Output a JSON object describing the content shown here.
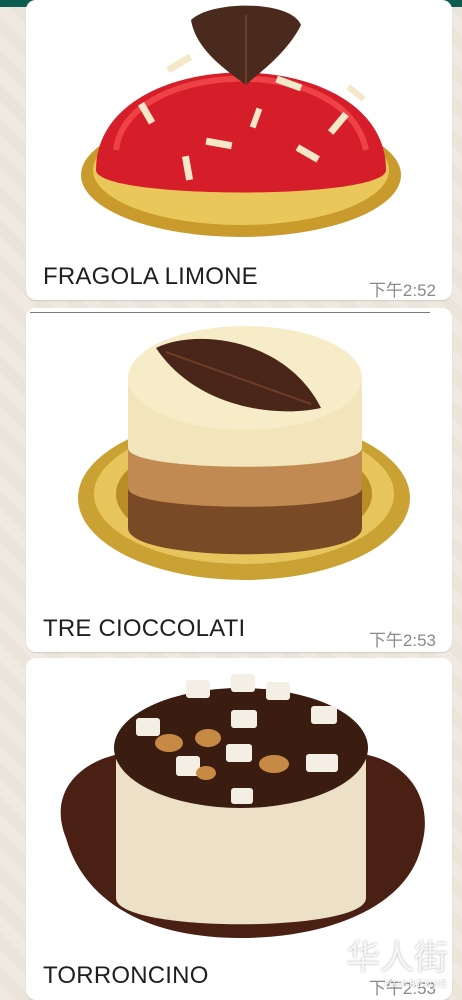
{
  "chat": {
    "messages": [
      {
        "image": "cake-strawberry-dome",
        "caption": "FRAGOLA LIMONE",
        "time": "下午2:52"
      },
      {
        "image": "cake-three-chocolate",
        "caption": "TRE CIOCCOLATI",
        "time": "下午2:53"
      },
      {
        "image": "cake-torroncino",
        "caption": "TORRONCINO",
        "time": "下午2:53"
      }
    ]
  },
  "watermark": {
    "text": "华人街",
    "sub": "HUARENJIE"
  },
  "colors": {
    "topbar": "#0b5e4f",
    "chat_bg": "#ece5dd",
    "bubble": "#ffffff",
    "timestamp": "#8a8a8a"
  }
}
